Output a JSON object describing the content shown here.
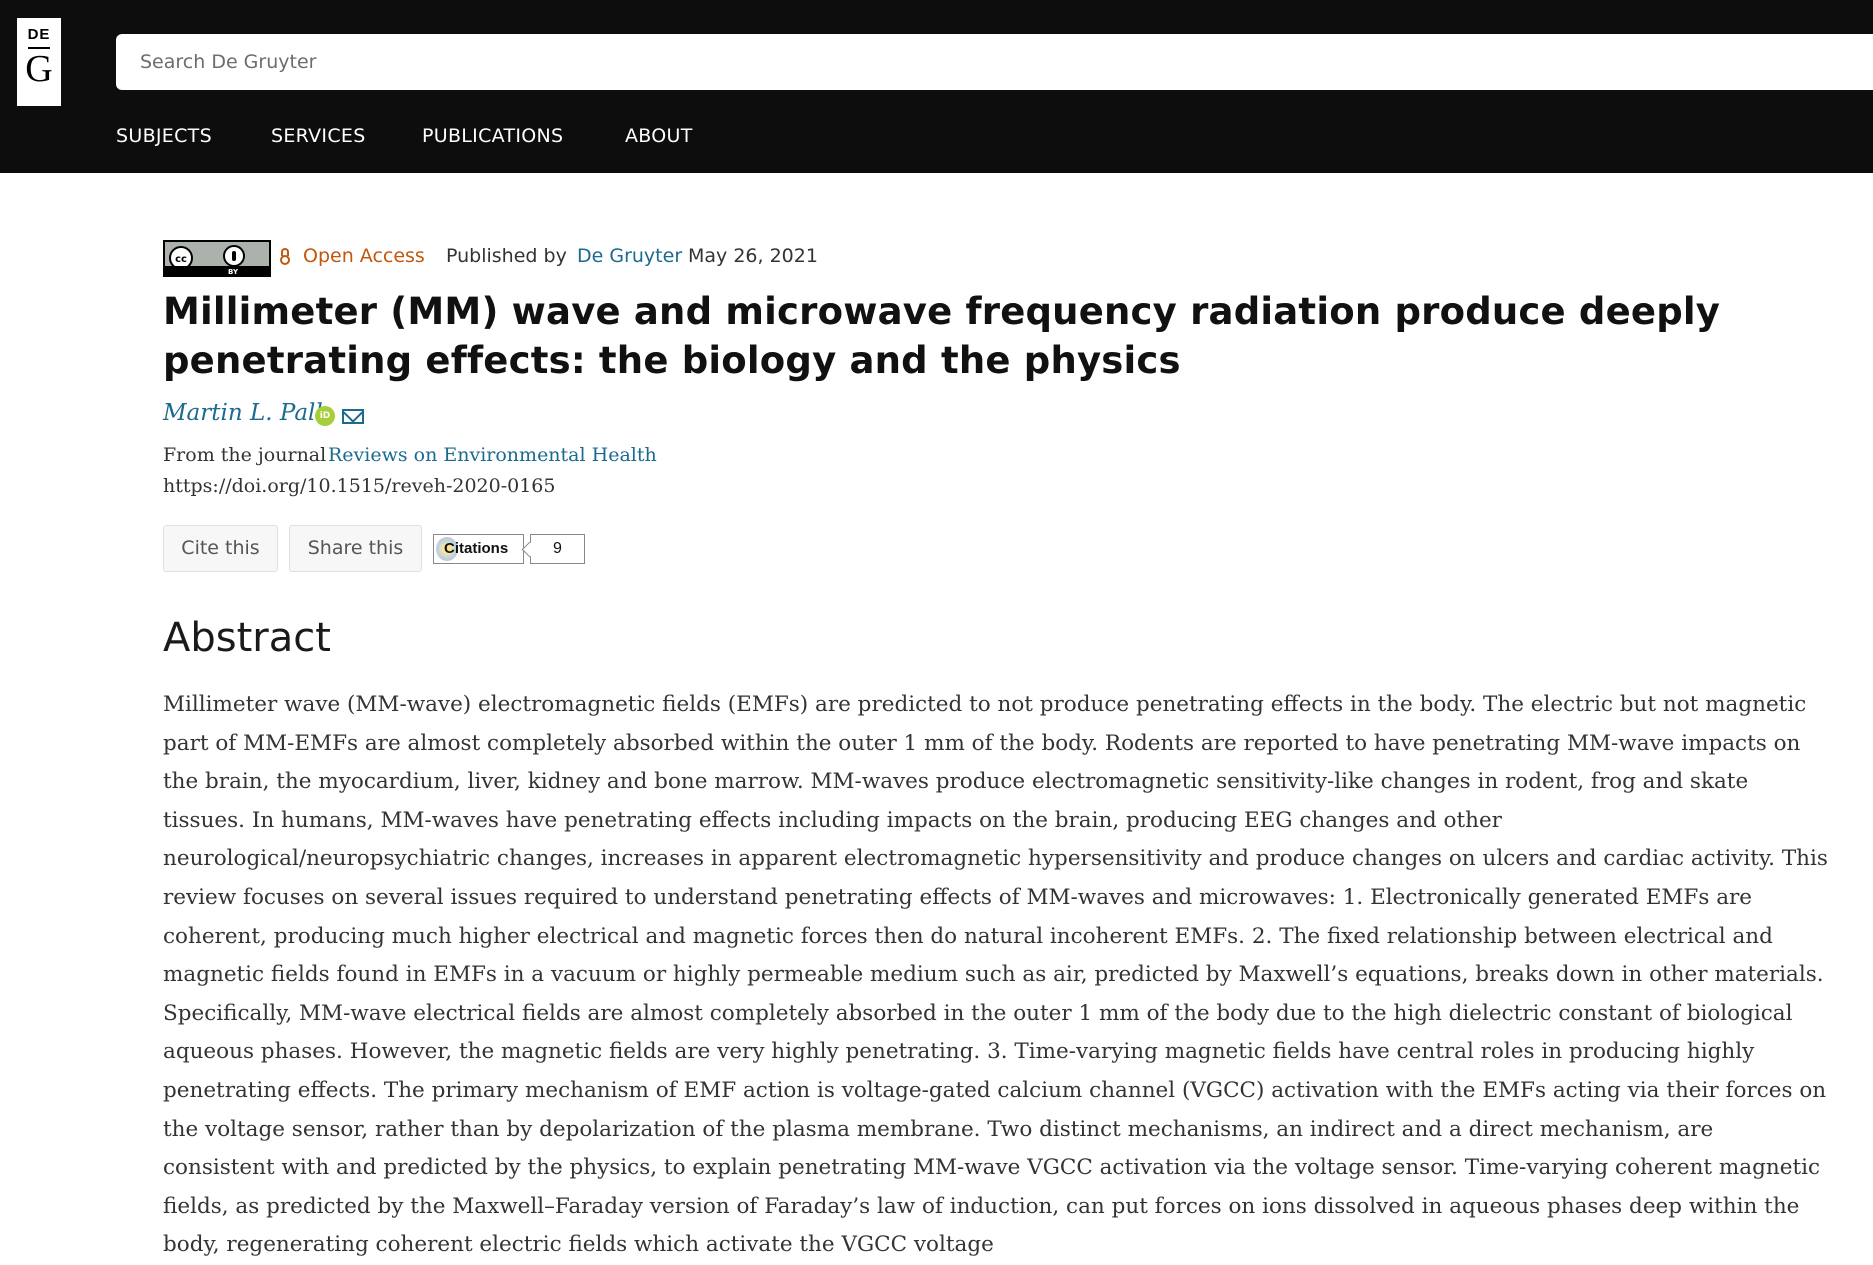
{
  "header": {
    "logo_top": "DE",
    "logo_bottom": "G",
    "search_placeholder": "Search De Gruyter",
    "nav": [
      "SUBJECTS",
      "SERVICES",
      "PUBLICATIONS",
      "ABOUT"
    ]
  },
  "meta": {
    "license_badge": "cc BY",
    "open_access": "Open Access",
    "published_by_prefix": "Published by",
    "publisher": "De Gruyter",
    "date": "May 26, 2021"
  },
  "article": {
    "title": "Millimeter (MM) wave and microwave frequency radiation produce deeply penetrating effects: the biology and the physics",
    "author": "Martin L. Pall",
    "journal_prefix": "From the journal",
    "journal": "Reviews on Environmental Health",
    "doi": "https://doi.org/10.1515/reveh-2020-0165"
  },
  "actions": {
    "cite": "Cite this",
    "share": "Share this",
    "citations_label": "Citations",
    "citations_count": "9"
  },
  "abstract": {
    "heading": "Abstract",
    "text": "Millimeter wave (MM-wave) electromagnetic fields (EMFs) are predicted to not produce penetrating effects in the body. The electric but not magnetic part of MM-EMFs are almost completely absorbed within the outer 1 mm of the body. Rodents are reported to have penetrating MM-wave impacts on the brain, the myocardium, liver, kidney and bone marrow. MM-waves produce electromagnetic sensitivity-like changes in rodent, frog and skate tissues. In humans, MM-waves have penetrating effects including impacts on the brain, producing EEG changes and other neurological/neuropsychiatric changes, increases in apparent electromagnetic hypersensitivity and produce changes on ulcers and cardiac activity. This review focuses on several issues required to understand penetrating effects of MM-waves and microwaves: 1. Electronically generated EMFs are coherent, producing much higher electrical and magnetic forces then do natural incoherent EMFs. 2. The fixed relationship between electrical and magnetic fields found in EMFs in a vacuum or highly permeable medium such as air, predicted by Maxwell’s equations, breaks down in other materials. Specifically, MM-wave electrical fields are almost completely absorbed in the outer 1 mm of the body due to the high dielectric constant of biological aqueous phases. However, the magnetic fields are very highly penetrating. 3. Time-varying magnetic fields have central roles in producing highly penetrating effects. The primary mechanism of EMF action is voltage-gated calcium channel (VGCC) activation with the EMFs acting via their forces on the voltage sensor, rather than by depolarization of the plasma membrane. Two distinct mechanisms, an indirect and a direct mechanism, are consistent with and predicted by the physics, to explain penetrating MM-wave VGCC activation via the voltage sensor. Time-varying coherent magnetic fields, as predicted by the Maxwell–Faraday version of Faraday’s law of induction, can put forces on ions dissolved in aqueous phases deep within the body, regenerating coherent electric fields which activate the VGCC voltage"
  }
}
